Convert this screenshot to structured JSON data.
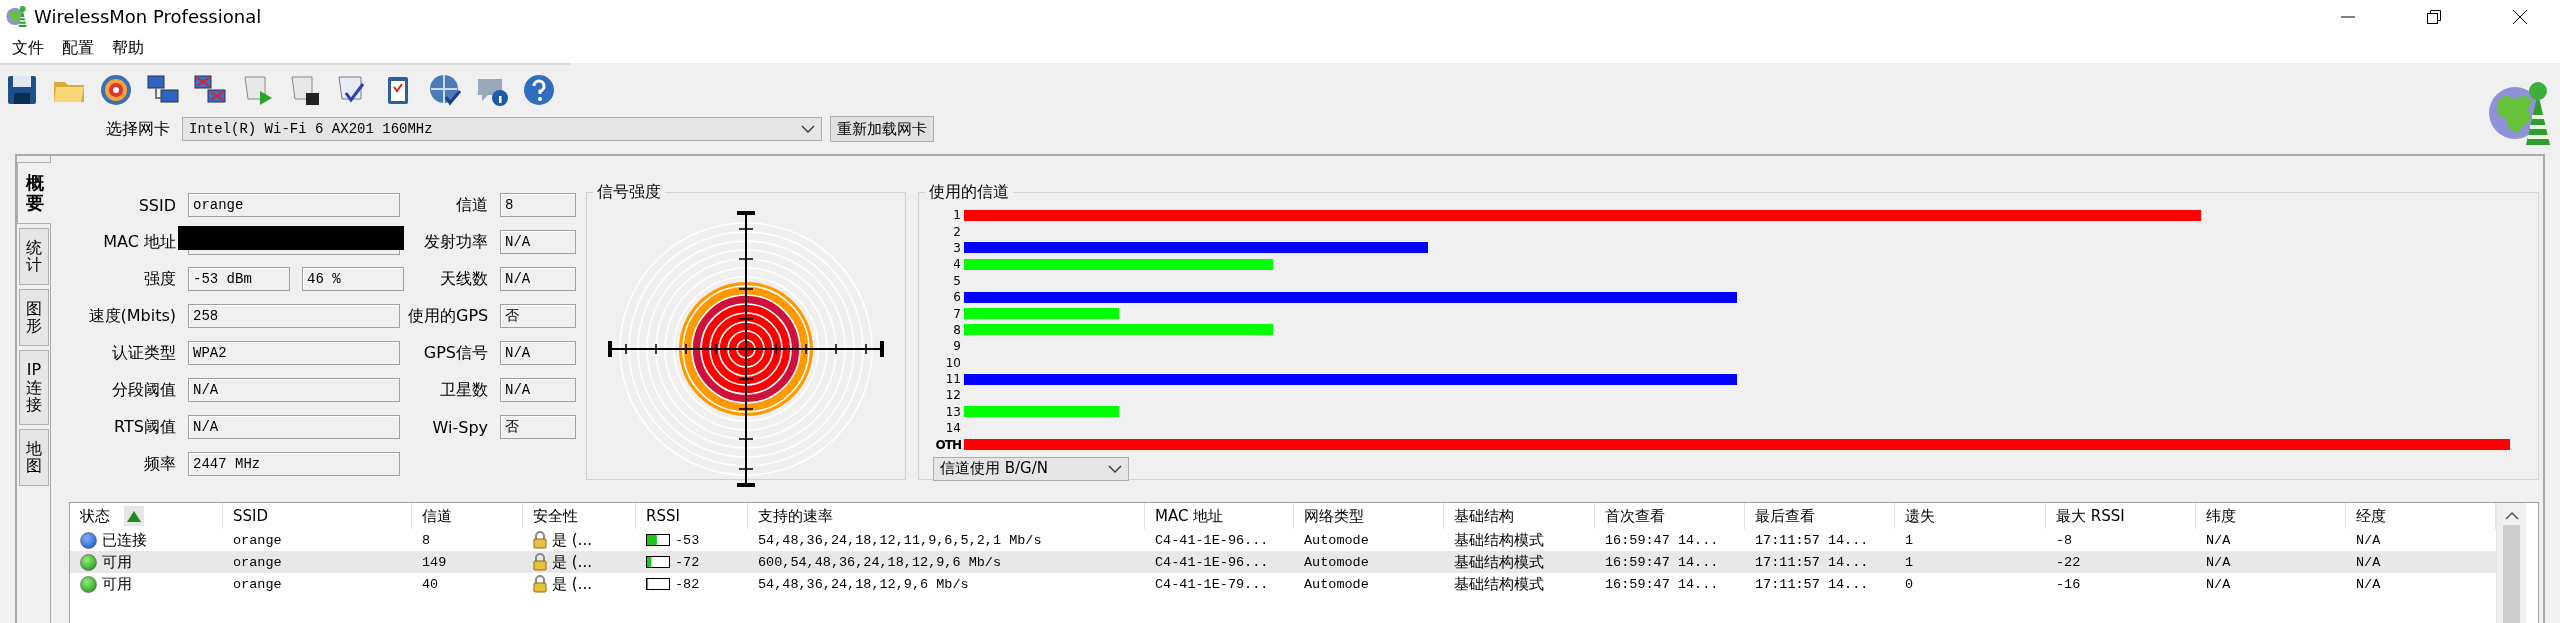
{
  "window": {
    "title": "WirelessMon Professional"
  },
  "menu": [
    {
      "label": "文件"
    },
    {
      "label": "配置"
    },
    {
      "label": "帮助"
    }
  ],
  "adapter": {
    "label": "选择网卡",
    "value": "Intel(R) Wi-Fi 6 AX201 160MHz",
    "reload_button": "重新加载网卡"
  },
  "side_tabs": [
    {
      "label": "概要",
      "selected": true
    },
    {
      "label": "统计",
      "selected": false
    },
    {
      "label": "图形",
      "selected": false
    },
    {
      "label": "IP 连接",
      "selected": false
    },
    {
      "label": "地图",
      "selected": false
    }
  ],
  "info_left": [
    {
      "label": "SSID",
      "values": [
        "orange"
      ]
    },
    {
      "label": "MAC 地址",
      "redacted": true
    },
    {
      "label": "强度",
      "values": [
        "-53 dBm",
        "46 %"
      ]
    },
    {
      "label": "速度(Mbits)",
      "values": [
        "258"
      ]
    },
    {
      "label": "认证类型",
      "values": [
        "WPA2"
      ]
    },
    {
      "label": "分段阈值",
      "values": [
        "N/A"
      ]
    },
    {
      "label": "RTS阈值",
      "values": [
        "N/A"
      ]
    },
    {
      "label": "频率",
      "values": [
        "2447 MHz"
      ]
    }
  ],
  "info_right": [
    {
      "label": "信道",
      "value": "8"
    },
    {
      "label": "发射功率",
      "value": "N/A"
    },
    {
      "label": "天线数",
      "value": "N/A"
    },
    {
      "label": "使用的GPS",
      "value": "否"
    },
    {
      "label": "GPS信号",
      "value": "N/A"
    },
    {
      "label": "卫星数",
      "value": "N/A"
    },
    {
      "label": "Wi-Spy",
      "value": "否"
    }
  ],
  "signal_panel": {
    "title": "信号强度"
  },
  "channel_panel": {
    "title": "使用的信道",
    "mode_select": "信道使用 B/G/N",
    "channels": [
      {
        "label": "1",
        "color": "#ff0000"
      },
      {
        "label": "2"
      },
      {
        "label": "3",
        "color": "#0000ff"
      },
      {
        "label": "4",
        "color": "#00ff00"
      },
      {
        "label": "5"
      },
      {
        "label": "6",
        "color": "#0000ff"
      },
      {
        "label": "7",
        "color": "#00ff00"
      },
      {
        "label": "8",
        "color": "#00ff00"
      },
      {
        "label": "9"
      },
      {
        "label": "10"
      },
      {
        "label": "11",
        "color": "#0000ff"
      },
      {
        "label": "12"
      },
      {
        "label": "13",
        "color": "#00ff00"
      },
      {
        "label": "14"
      },
      {
        "label": "OTH",
        "color": "#ff0000"
      }
    ]
  },
  "table": {
    "columns": [
      {
        "label": "状态",
        "sorted": true
      },
      {
        "label": "SSID",
        "sorted": false
      },
      {
        "label": "信道",
        "sorted": false
      },
      {
        "label": "安全性",
        "sorted": false
      },
      {
        "label": "RSSI",
        "sorted": false
      },
      {
        "label": "支持的速率",
        "sorted": false
      },
      {
        "label": "MAC 地址",
        "sorted": false
      },
      {
        "label": "网络类型",
        "sorted": false
      },
      {
        "label": "基础结构",
        "sorted": false
      },
      {
        "label": "首次查看",
        "sorted": false
      },
      {
        "label": "最后查看",
        "sorted": false
      },
      {
        "label": "遗失",
        "sorted": false
      },
      {
        "label": "最大 RSSI",
        "sorted": false
      },
      {
        "label": "纬度",
        "sorted": false
      },
      {
        "label": "经度",
        "sorted": false
      }
    ],
    "rows": [
      {
        "kind": "connected",
        "selected": false,
        "status": "已连接",
        "ssid": "orange",
        "channel": "8",
        "security": "是 (...",
        "level": 0.45,
        "rssi": "-53",
        "rates": "54,48,36,24,18,12,11,9,6,5,2,1 Mb/s",
        "mac": "C4-41-1E-96...",
        "network_type": "Automode",
        "infrastructure": "基础结构模式",
        "first_seen": "16:59:47 14...",
        "last_seen": "17:11:57 14...",
        "lost": "1",
        "max_rssi": "-8",
        "latitude": "N/A",
        "longitude": "N/A"
      },
      {
        "kind": "available",
        "selected": true,
        "status": "可用",
        "ssid": "orange",
        "channel": "149",
        "security": "是 (...",
        "level": 0.2,
        "rssi": "-72",
        "rates": "600,54,48,36,24,18,12,9,6 Mb/s",
        "mac": "C4-41-1E-96...",
        "network_type": "Automode",
        "infrastructure": "基础结构模式",
        "first_seen": "16:59:47 14...",
        "last_seen": "17:11:57 14...",
        "lost": "1",
        "max_rssi": "-22",
        "latitude": "N/A",
        "longitude": "N/A"
      },
      {
        "kind": "available",
        "selected": false,
        "status": "可用",
        "ssid": "orange",
        "channel": "40",
        "security": "是 (...",
        "level": 0.05,
        "rssi": "-82",
        "rates": "54,48,36,24,18,12,9,6 Mb/s",
        "mac": "C4-41-1E-79...",
        "network_type": "Automode",
        "infrastructure": "基础结构模式",
        "first_seen": "16:59:47 14...",
        "last_seen": "17:11:57 14...",
        "lost": "0",
        "max_rssi": "-16",
        "latitude": "N/A",
        "longitude": "N/A"
      }
    ]
  }
}
